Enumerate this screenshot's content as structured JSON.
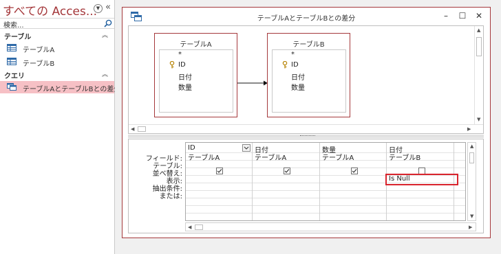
{
  "nav": {
    "title": "すべての Acces...",
    "search_placeholder": "検索...",
    "groups": [
      {
        "label": "テーブル",
        "items": [
          {
            "label": "テーブルA"
          },
          {
            "label": "テーブルB"
          }
        ]
      },
      {
        "label": "クエリ",
        "items": [
          {
            "label": "テーブルAとテーブルBとの差分",
            "selected": true
          }
        ]
      }
    ]
  },
  "query": {
    "title": "テーブルAとテーブルBとの差分",
    "window_buttons": {
      "minimize": "–",
      "restore": "☐",
      "close": "✕"
    },
    "tables": [
      {
        "name": "テーブルA",
        "fields": [
          "*",
          "ID",
          "日付",
          "数量"
        ],
        "key_field": "ID"
      },
      {
        "name": "テーブルB",
        "fields": [
          "*",
          "ID",
          "日付",
          "数量"
        ],
        "key_field": "ID"
      }
    ],
    "grid": {
      "row_labels": [
        "フィールド:",
        "テーブル:",
        "並べ替え:",
        "表示:",
        "抽出条件:",
        "または:"
      ],
      "columns": [
        {
          "field": "ID",
          "table": "テーブルA",
          "show": true,
          "criteria": ""
        },
        {
          "field": "日付",
          "table": "テーブルA",
          "show": true,
          "criteria": ""
        },
        {
          "field": "数量",
          "table": "テーブルA",
          "show": true,
          "criteria": ""
        },
        {
          "field": "日付",
          "table": "テーブルB",
          "show": false,
          "criteria": "Is Null"
        }
      ]
    }
  },
  "colors": {
    "accent": "#a4373a",
    "selected_bg": "#f6c0c5",
    "highlight": "#d9232c"
  }
}
